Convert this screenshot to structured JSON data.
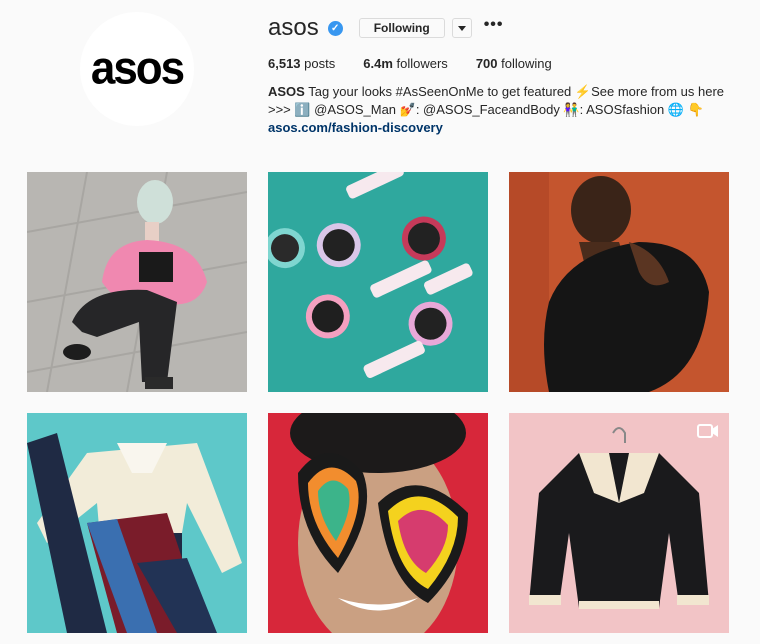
{
  "profile": {
    "avatar_text": "asos",
    "username": "asos",
    "follow_button": "Following",
    "more": "•••",
    "stats": {
      "posts_count": "6,513",
      "posts_label": "posts",
      "followers_count": "6.4m",
      "followers_label": "followers",
      "following_count": "700",
      "following_label": "following"
    },
    "bio": {
      "name": "ASOS",
      "line1": "Tag your looks #AsSeenOnMe to get featured ⚡See more from us here",
      "line2": ">>> ℹ️ @ASOS_Man 💅: @ASOS_FaceandBody 👫: ASOSfashion 🌐 👇",
      "link": "asos.com/fashion-discovery"
    }
  },
  "posts": [
    {
      "subject": "woman in pink fur jacket crouching"
    },
    {
      "subject": "NYX cosmetics jars on teal background"
    },
    {
      "subject": "man in black fur coat on orange background"
    },
    {
      "subject": "sportswear flat lay on turquoise background"
    },
    {
      "subject": "woman with painted heart face makeup"
    },
    {
      "subject": "black shearling jacket on hanger",
      "video": true
    }
  ],
  "icons": {
    "verified": "verified-check-icon",
    "dropdown": "chevron-down-icon",
    "video": "video-camera-icon"
  },
  "colors": {
    "verified_blue": "#3897f0",
    "link_blue": "#003569",
    "background": "#fafafa",
    "border": "#dbdbdb"
  }
}
